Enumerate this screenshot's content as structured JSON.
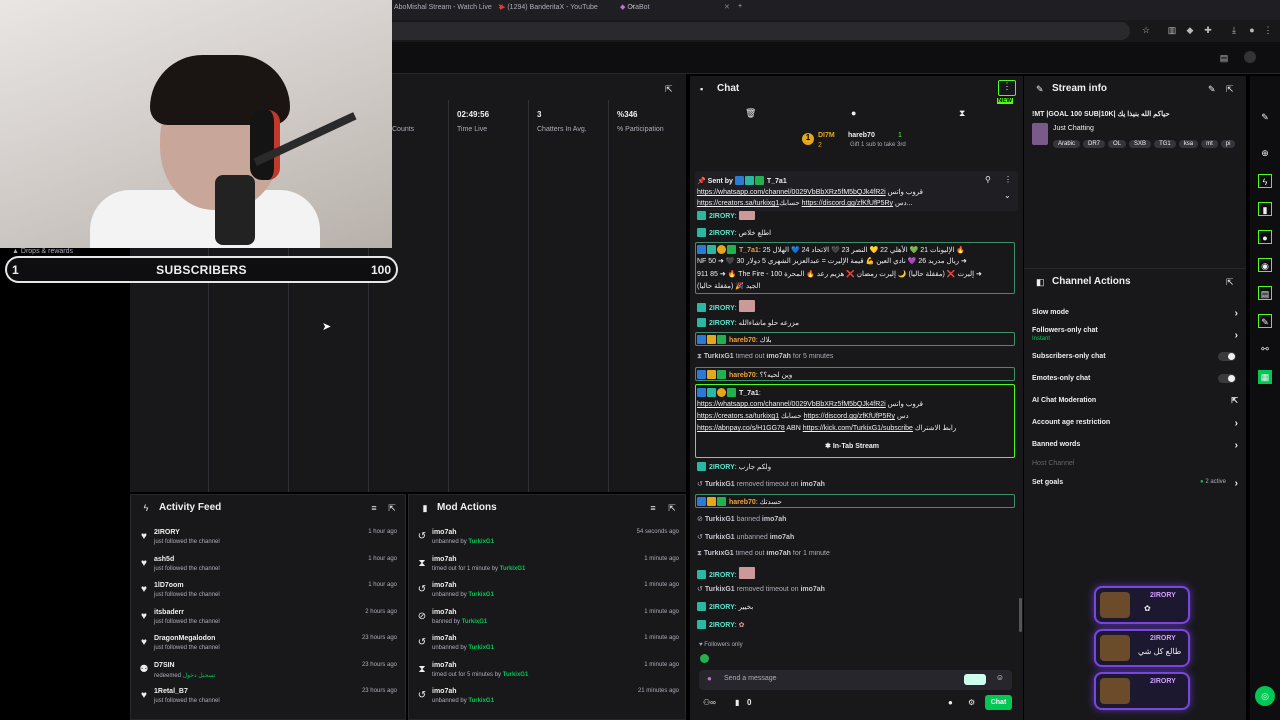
{
  "browser": {
    "tabs": [
      {
        "label": "AboMishal Stream - Watch Live"
      },
      {
        "label": "(1294) BanderitaX - YouTube"
      },
      {
        "label": "OraBot"
      }
    ]
  },
  "overlay": {
    "drops_label": "Drops & rewards",
    "sub_goal": {
      "current": "1",
      "label": "SUBSCRIBERS",
      "target": "100",
      "progress": 0.01
    }
  },
  "stats": [
    {
      "value": "",
      "label": "Counts"
    },
    {
      "value": "02:49:56",
      "label": "Time Live"
    },
    {
      "value": "3",
      "label": "Chatters In Avg."
    },
    {
      "value": "%346",
      "label": "% Participation"
    }
  ],
  "activity_feed": {
    "title": "Activity Feed",
    "items": [
      {
        "name": "2IRORY",
        "desc": "just followed the channel",
        "time": "1 hour ago",
        "icon": "heart-icon"
      },
      {
        "name": "ash5d",
        "desc": "just followed the channel",
        "time": "1 hour ago",
        "icon": "heart-icon"
      },
      {
        "name": "1lD7oom",
        "desc": "just followed the channel",
        "time": "1 hour ago",
        "icon": "heart-icon"
      },
      {
        "name": "itsbaderr",
        "desc": "just followed the channel",
        "time": "2 hours ago",
        "icon": "heart-icon"
      },
      {
        "name": "DragonMegalodon",
        "desc": "just followed the channel",
        "time": "23 hours ago",
        "icon": "heart-icon"
      },
      {
        "name": "D7SIN",
        "desc": "redeemed",
        "extra": "تسجيل دخول",
        "time": "23 hours ago",
        "icon": "points-icon"
      },
      {
        "name": "1Retal_B7",
        "desc": "just followed the channel",
        "time": "23 hours ago",
        "icon": "heart-icon"
      }
    ]
  },
  "mod_actions": {
    "title": "Mod Actions",
    "items": [
      {
        "name": "imo7ah",
        "desc": "unbanned by",
        "by": "TurkixG1",
        "time": "54 seconds ago",
        "icon": "undo-icon"
      },
      {
        "name": "imo7ah",
        "desc": "timed out for 1 minute by",
        "by": "TurkixG1",
        "time": "1 minute ago",
        "icon": "hourglass-icon"
      },
      {
        "name": "imo7ah",
        "desc": "unbanned by",
        "by": "TurkixG1",
        "time": "1 minute ago",
        "icon": "undo-icon"
      },
      {
        "name": "imo7ah",
        "desc": "banned by",
        "by": "TurkixG1",
        "time": "1 minute ago",
        "icon": "ban-icon"
      },
      {
        "name": "imo7ah",
        "desc": "unbanned by",
        "by": "TurkixG1",
        "time": "1 minute ago",
        "icon": "undo-icon"
      },
      {
        "name": "imo7ah",
        "desc": "timed out for 5 minutes by",
        "by": "TurkixG1",
        "time": "1 minute ago",
        "icon": "hourglass-icon"
      },
      {
        "name": "imo7ah",
        "desc": "unbanned by",
        "by": "TurkixG1",
        "time": "21 minutes ago",
        "icon": "undo-icon"
      }
    ]
  },
  "chat": {
    "title": "Chat",
    "new_label": "NEW",
    "leaderboard": {
      "first": "DI7M",
      "first_count": "2",
      "second": "hareb70",
      "second_count": "1",
      "gift_text": "Gift 1 sub to take 3rd"
    },
    "pinned": {
      "sent_by_label": "Sent by",
      "user": "T_7a1",
      "line1_link": "https://whatsapp.com/channel/0029VbBbXRz5fM5bQJk4fR2i",
      "line1_text": "قروب واتس",
      "line2_link": "https://creators.sa/turkixg1",
      "line2_text": "حسابك",
      "line2_link2": "https://discord.gg/zfKfUfP5Ry",
      "line2_tail": "دس..."
    },
    "messages": {
      "m1_user": "2IRORY",
      "m2_user": "2IRORY",
      "m2_text": "اطلع خلاص",
      "m3_user": "T_7a1",
      "m3_l1": "الإليونات 21 💚 الأهلي 22 💛 النصر 23 🖤 الاتحاد 24 💙 الهلال 25 🔥",
      "m3_l2": "NF 50 ➜ 🖤 ريال مدريد 26 💜 نادي العين 💪 قيمة الإليرت = عبدالعزيز الشهري 5 دولار 30 ➜",
      "m3_l3": "911 85 ➜ 🔥 The Fire - إليرت ❌ (مقفلة حاليا) 🌙 إليرت رمضان ❌ هزيم رعد 🔥 المحرة 100 ➜",
      "m3_l4": "الجيد 🎉 (مقفلة حاليا)",
      "m4_user": "2IRORY",
      "m5_user": "2IRORY",
      "m5_text": "مزرعه حلو ماشاءالله",
      "m6_user": "hareb70",
      "m6_text": "بلاك",
      "m7_sys_user": "TurkixG1",
      "m7_mid": "timed out",
      "m7_target": "imo7ah",
      "m7_tail": "for 5 minutes",
      "m8_user": "hareb70",
      "m8_text": "وين لحيه؟؟",
      "m9_user": "T_7a1",
      "m9_l1_link": "https://whatsapp.com/channel/0029VbBbXRz5fM5bQJk4fR2i",
      "m9_l1_text": "قروب واتس",
      "m9_l2_link": "https://creators.sa/turkixg1",
      "m9_l2_text": "حسابك",
      "m9_l2_link2": "https://discord.gg/zfKfUfP5Ry",
      "m9_l2_tail": "دس",
      "m9_l3_link": "https://abnpay.co/s/H1GG78",
      "m9_l3_mid": "ABN",
      "m9_l3_link2": "https://kick.com/TurkixG1/subscribe",
      "m9_l3_tail": "رابط الاشتراك",
      "m9_tag": "In-Tab Stream",
      "m10_user": "2IRORY",
      "m10_text": "ولكم جارب",
      "m11_user": "TurkixG1",
      "m11_mid": "removed timeout on",
      "m11_target": "imo7ah",
      "m12_user": "hareb70",
      "m12_text": "حسدتك",
      "m13_user": "TurkixG1",
      "m13_mid": "banned",
      "m13_target": "imo7ah",
      "m14_user": "TurkixG1",
      "m14_mid": "unbanned",
      "m14_target": "imo7ah",
      "m15_user": "TurkixG1",
      "m15_mid": "timed out",
      "m15_target": "imo7ah",
      "m15_tail": "for 1 minute",
      "m16_user": "2IRORY",
      "m17_user": "TurkixG1",
      "m17_mid": "removed timeout on",
      "m17_target": "imo7ah",
      "m18_user": "2IRORY",
      "m18_text": "بخيير",
      "m19_user": "2IRORY"
    },
    "followers_only_label": "Followers only",
    "input_placeholder": "Send a message",
    "viewer_count": "0",
    "chat_button": "Chat"
  },
  "stream_info": {
    "title": "Stream info",
    "stream_title": "!MT |GOAL 100 SUB|10K| حياكم الله بنيذا يك",
    "category": "Just Chatting",
    "tags": [
      "Arabic",
      "DR7",
      "OL",
      "SXB",
      "TG1",
      "ksa",
      "mt",
      "pi"
    ]
  },
  "channel_actions": {
    "title": "Channel Actions",
    "slow_mode": "Slow mode",
    "followers_only": "Followers-only chat",
    "followers_only_sub": "Instant",
    "subscribers_only": "Subscribers-only chat",
    "emotes_only": "Emotes-only chat",
    "ai_moderation": "AI Chat Moderation",
    "age_restriction": "Account age restriction",
    "banned_words": "Banned words",
    "host_channel": "Host Channel",
    "set_goals": "Set goals",
    "set_goals_status": "2 active"
  },
  "alerts": [
    {
      "name": "2IRORY",
      "msg": ""
    },
    {
      "name": "2IRORY",
      "msg": "طالع كل شي"
    },
    {
      "name": "2IRORY",
      "msg": ""
    }
  ],
  "colors": {
    "accent_green": "#00c853",
    "kick_green": "#53fc18",
    "purple_alert": "#7b46e0"
  }
}
